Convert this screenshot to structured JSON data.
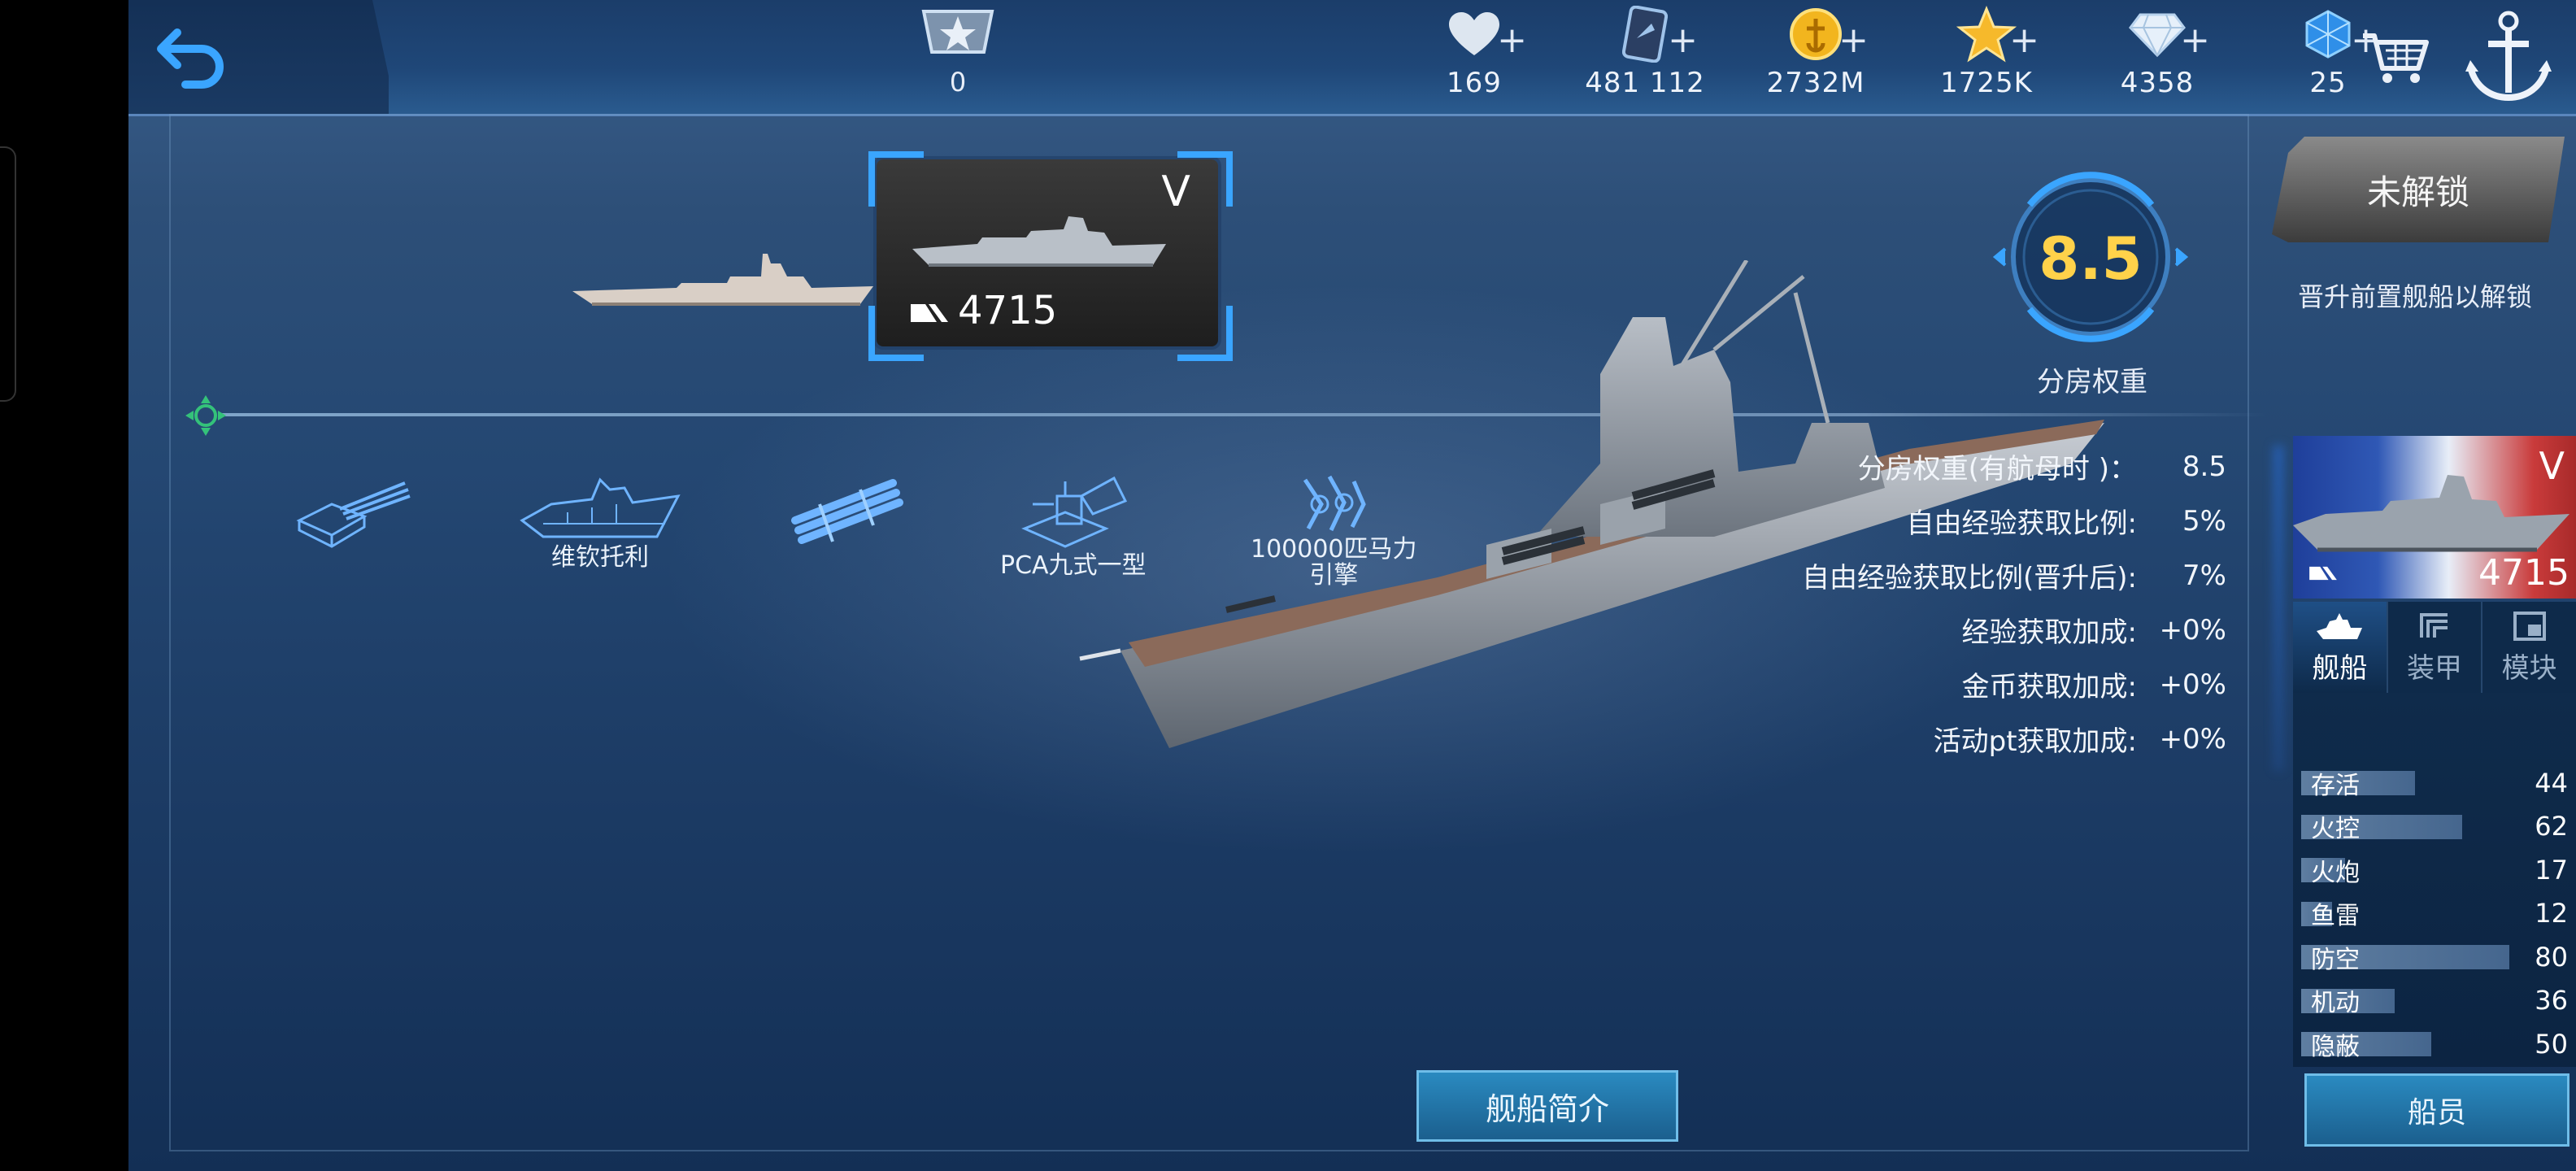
{
  "topbar": {
    "rank_count": "0",
    "resources": [
      {
        "name": "heart-icon",
        "value": "169"
      },
      {
        "name": "card-icon",
        "value": "481 112"
      },
      {
        "name": "gold-coin-icon",
        "value": "2732M"
      },
      {
        "name": "star-icon",
        "value": "1725K"
      },
      {
        "name": "diamond-icon",
        "value": "4358"
      },
      {
        "name": "blue-gem-icon",
        "value": "25"
      }
    ],
    "plus": "+"
  },
  "selected_ship": {
    "tier": "V",
    "id": "4715"
  },
  "modules": [
    {
      "name": "turret-module",
      "label": ""
    },
    {
      "name": "hull-module",
      "label": "维钦托利"
    },
    {
      "name": "torpedo-module",
      "label": ""
    },
    {
      "name": "radar-module",
      "label": "PCA九式一型"
    },
    {
      "name": "engine-module",
      "label": "100000匹马力\n引擎"
    }
  ],
  "rating": {
    "value": "8.5",
    "label": "分房权重"
  },
  "stats": [
    {
      "label": "分房权重(有航母时 )：",
      "value": "8.5"
    },
    {
      "label": "自由经验获取比例:",
      "value": "5%"
    },
    {
      "label": "自由经验获取比例(晋升后):",
      "value": "7%"
    },
    {
      "label": "经验获取加成:",
      "value": "+0%"
    },
    {
      "label": "金币获取加成:",
      "value": "+0%"
    },
    {
      "label": "活动pt获取加成:",
      "value": "+0%"
    }
  ],
  "intro_button": "舰船简介",
  "right_panel": {
    "locked_button": "未解锁",
    "unlock_hint": "晋升前置舰船以解锁",
    "portrait_tier": "V",
    "portrait_id": "4715",
    "tabs": [
      {
        "label": "舰船",
        "icon": "ship-tab-icon",
        "active": true
      },
      {
        "label": "装甲",
        "icon": "armor-tab-icon",
        "active": false
      },
      {
        "label": "模块",
        "icon": "module-tab-icon",
        "active": false
      }
    ],
    "attributes": [
      {
        "name": "存活",
        "value": "44"
      },
      {
        "name": "火控",
        "value": "62"
      },
      {
        "name": "火炮",
        "value": "17"
      },
      {
        "name": "鱼雷",
        "value": "12"
      },
      {
        "name": "防空",
        "value": "80"
      },
      {
        "name": "机动",
        "value": "36"
      },
      {
        "name": "隐蔽",
        "value": "50"
      }
    ],
    "crew_button": "船员"
  }
}
